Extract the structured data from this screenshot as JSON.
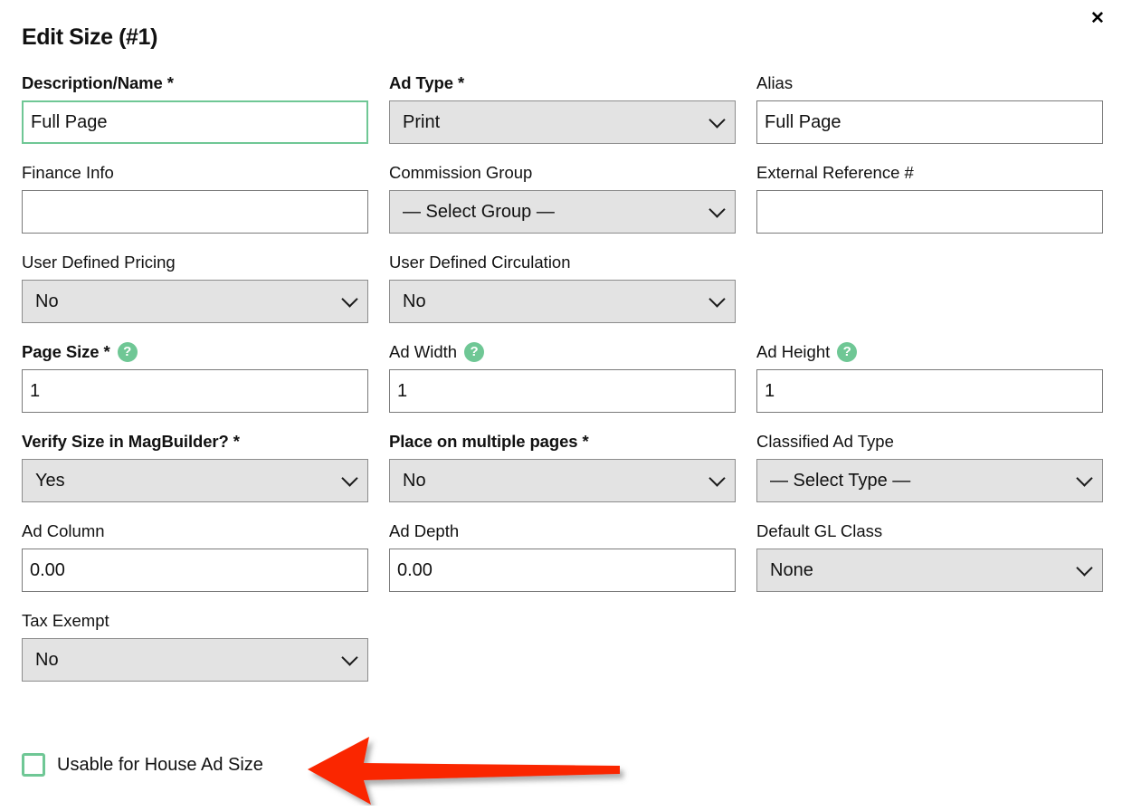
{
  "modal": {
    "title": "Edit Size (#1)",
    "close_label": "✕"
  },
  "icons": {
    "help": "?"
  },
  "colors": {
    "accent_green": "#6fc795",
    "select_fill": "#e3e3e3",
    "annotation_red": "#fa2800"
  },
  "fields": {
    "description_name": {
      "label": "Description/Name *",
      "value": "Full Page",
      "placeholder": ""
    },
    "ad_type": {
      "label": "Ad Type *",
      "value": "Print"
    },
    "alias": {
      "label": "Alias",
      "value": "Full Page",
      "placeholder": ""
    },
    "finance_info": {
      "label": "Finance Info",
      "value": "",
      "placeholder": ""
    },
    "commission_group": {
      "label": "Commission Group",
      "value": "— Select Group —"
    },
    "external_reference": {
      "label": "External Reference #",
      "value": "",
      "placeholder": ""
    },
    "user_defined_pricing": {
      "label": "User Defined Pricing",
      "value": "No"
    },
    "user_defined_circulation": {
      "label": "User Defined Circulation",
      "value": "No"
    },
    "page_size": {
      "label": "Page Size *",
      "value": "1",
      "placeholder": ""
    },
    "ad_width": {
      "label": "Ad Width",
      "value": "1",
      "placeholder": ""
    },
    "ad_height": {
      "label": "Ad Height",
      "value": "1",
      "placeholder": ""
    },
    "verify_size": {
      "label": "Verify Size in MagBuilder? *",
      "value": "Yes"
    },
    "place_multiple_pages": {
      "label": "Place on multiple pages *",
      "value": "No"
    },
    "classified_ad_type": {
      "label": "Classified Ad Type",
      "value": "— Select Type —"
    },
    "ad_column": {
      "label": "Ad Column",
      "value": "0.00",
      "placeholder": ""
    },
    "ad_depth": {
      "label": "Ad Depth",
      "value": "0.00",
      "placeholder": ""
    },
    "default_gl_class": {
      "label": "Default GL Class",
      "value": "None"
    },
    "tax_exempt": {
      "label": "Tax Exempt",
      "value": "No"
    },
    "usable_house_ad_size": {
      "label": "Usable for House Ad Size",
      "checked": false
    }
  }
}
